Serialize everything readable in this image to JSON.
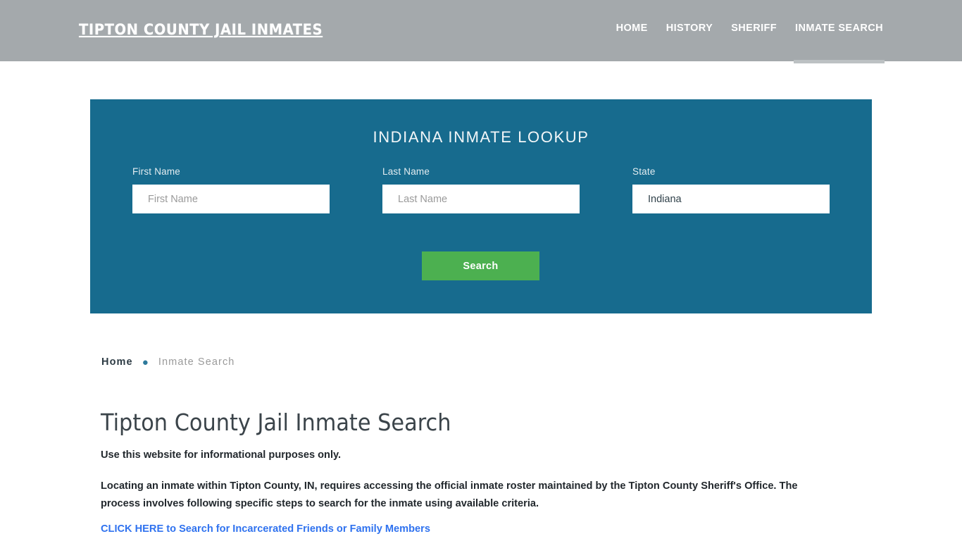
{
  "header": {
    "logo": "TIPTON COUNTY JAIL INMATES",
    "nav": [
      {
        "label": "HOME",
        "active": false
      },
      {
        "label": "HISTORY",
        "active": false
      },
      {
        "label": "SHERIFF",
        "active": false
      },
      {
        "label": "INMATE SEARCH",
        "active": true
      }
    ],
    "background_color": "#a4a9ac"
  },
  "lookup": {
    "title": "INDIANA INMATE LOOKUP",
    "panel_color": "#176b8e",
    "first_name": {
      "label": "First Name",
      "placeholder": "First Name",
      "value": ""
    },
    "last_name": {
      "label": "Last Name",
      "placeholder": "Last Name",
      "value": ""
    },
    "state": {
      "label": "State",
      "placeholder": "State",
      "value": "Indiana"
    },
    "search_button": {
      "label": "Search",
      "color": "#4cb050"
    }
  },
  "breadcrumb": {
    "home": "Home",
    "separator": "●",
    "current": "Inmate Search",
    "separator_color": "#2e7a9c"
  },
  "main": {
    "title": "Tipton County Jail Inmate Search",
    "lead": "Use this website for informational purposes only.",
    "paragraph": "Locating an inmate within Tipton County, IN, requires accessing the official inmate roster maintained by the Tipton County Sheriff's Office. The process involves following specific steps to search for the inmate using available criteria.",
    "cta_link": "CLICK HERE to Search for Incarcerated Friends or Family Members",
    "cta_link_color": "#2f72ef"
  }
}
